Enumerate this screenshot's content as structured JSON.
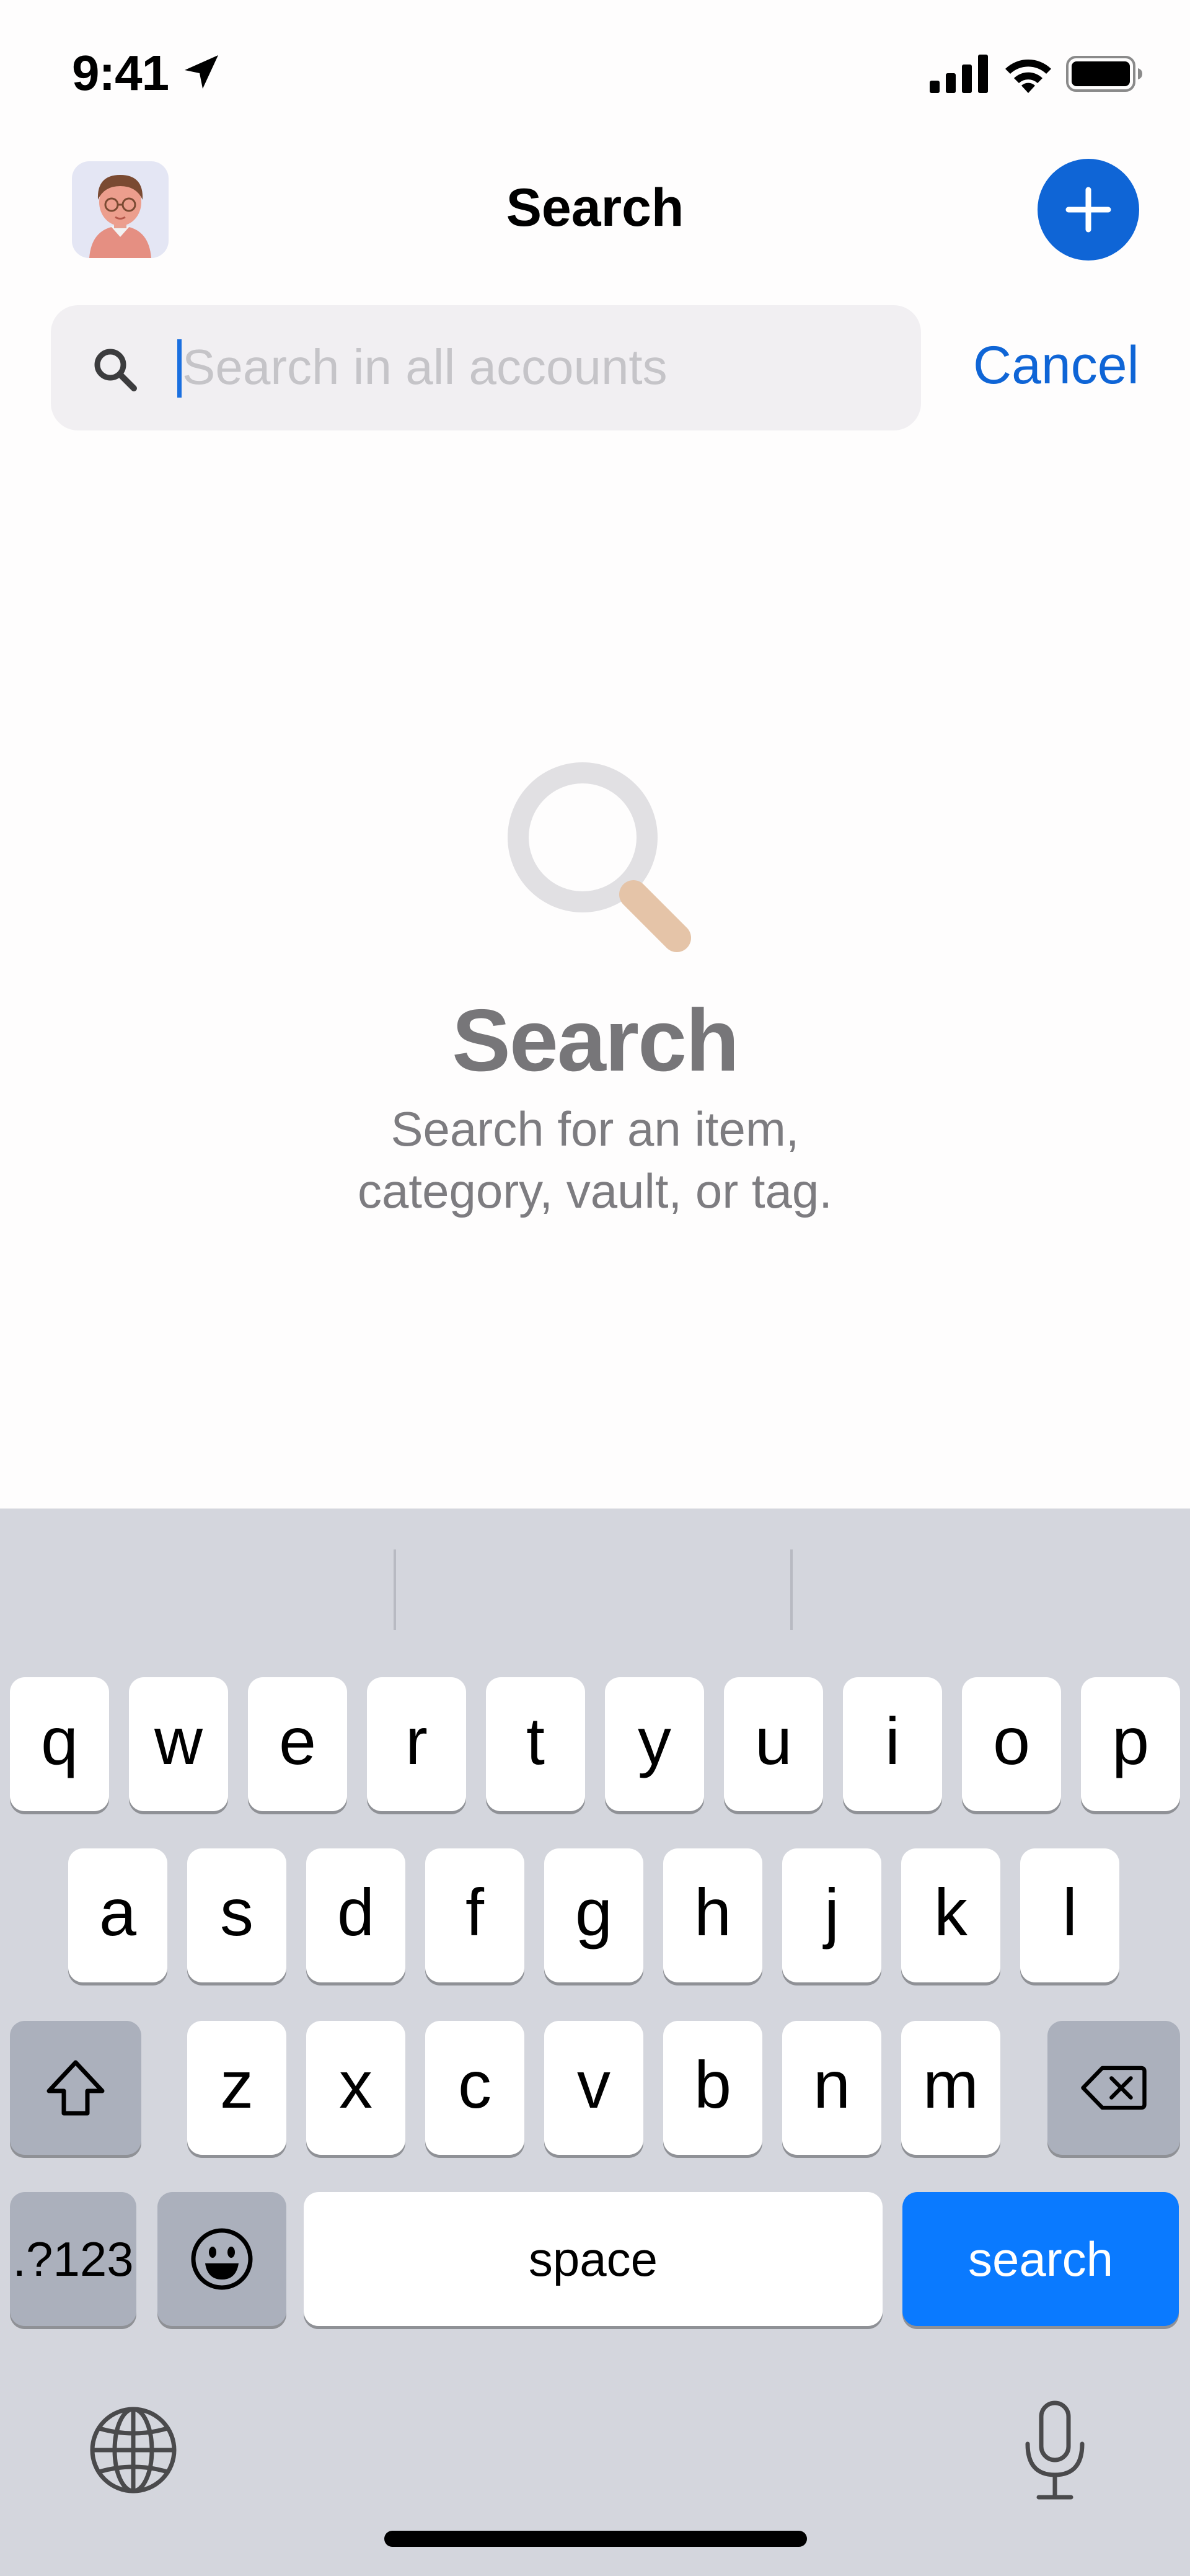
{
  "status_bar": {
    "time": "9:41"
  },
  "header": {
    "title": "Search",
    "add_icon": "plus-icon",
    "avatar_icon": "user-avatar"
  },
  "search": {
    "placeholder": "Search in all accounts",
    "value": "",
    "cancel_label": "Cancel"
  },
  "empty_state": {
    "icon": "magnifying-glass-icon",
    "title": "Search",
    "subtitle": "Search for an item,\ncategory, vault, or tag."
  },
  "keyboard": {
    "row1": [
      "q",
      "w",
      "e",
      "r",
      "t",
      "y",
      "u",
      "i",
      "o",
      "p"
    ],
    "row2": [
      "a",
      "s",
      "d",
      "f",
      "g",
      "h",
      "j",
      "k",
      "l"
    ],
    "row3": [
      "z",
      "x",
      "c",
      "v",
      "b",
      "n",
      "m"
    ],
    "numbers_label": ".?123",
    "space_label": "space",
    "return_label": "search"
  },
  "colors": {
    "accent": "#0f65d6",
    "keyboard_return": "#0a7aff",
    "keyboard_bg": "#d4d6dd"
  }
}
